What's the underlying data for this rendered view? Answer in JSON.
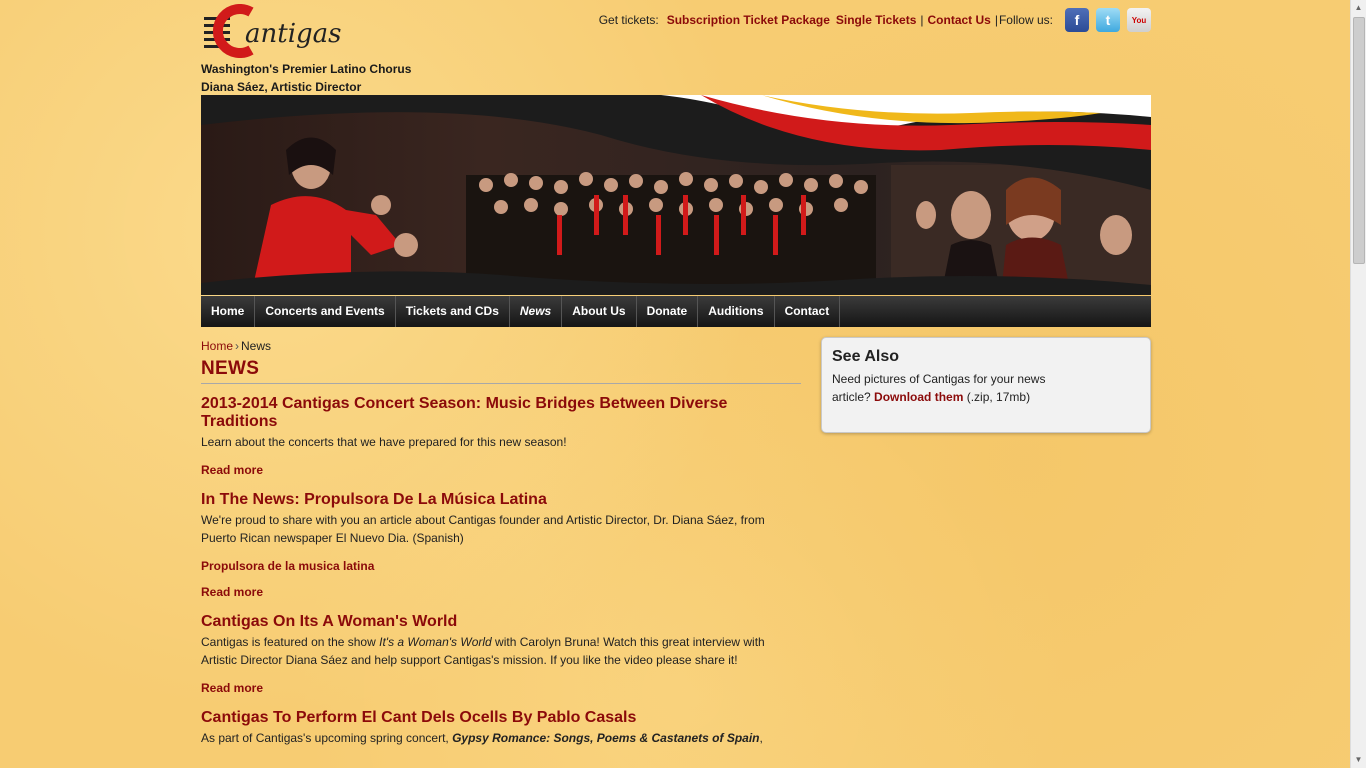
{
  "site": {
    "logo_text": "Cantigas",
    "tagline_1": "Washington's Premier Latino Chorus",
    "tagline_2": "Diana Sáez, Artistic Director"
  },
  "topbar": {
    "get_tickets_label": "Get tickets:",
    "subscription": "Subscription Ticket Package",
    "single": "Single Tickets",
    "contact": "Contact Us",
    "follow_label": "Follow us:",
    "social_icons": [
      "facebook-icon",
      "twitter-icon",
      "youtube-icon"
    ]
  },
  "nav": {
    "items": [
      "Home",
      "Concerts and Events",
      "Tickets and CDs",
      "News",
      "About Us",
      "Donate",
      "Auditions",
      "Contact"
    ],
    "active": "News"
  },
  "breadcrumb": {
    "home": "Home",
    "current": "News"
  },
  "page_title": "NEWS",
  "posts": [
    {
      "title": "2013-2014 Cantigas Concert Season: Music Bridges Between Diverse Traditions",
      "body": "Learn about the concerts that we have prepared for this new season!",
      "read_more": "Read more"
    },
    {
      "title": "In The News: Propulsora De La Música Latina",
      "body": "We're proud to share with you an article about Cantigas founder and Artistic Director, Dr. Diana Sáez, from Puerto Rican newspaper El Nuevo Dia. (Spanish)",
      "link": "Propulsora de la musica latina",
      "read_more": "Read more"
    },
    {
      "title": "Cantigas On Its A Woman's World",
      "body_pre": "Cantigas is featured on the show ",
      "body_em": "It's a Woman's World",
      "body_post": " with Carolyn Bruna! Watch this great interview with Artistic Director Diana Sáez and help support Cantigas's mission. If you like the video please share it!",
      "read_more": "Read more"
    },
    {
      "title": "Cantigas To Perform El Cant Dels Ocells By Pablo Casals",
      "body_pre": "As part of Cantigas's upcoming spring concert, ",
      "body_em": "Gypsy Romance: Songs, Poems & Castanets of Spain",
      "body_post": ","
    }
  ],
  "sidebar": {
    "title": "See Also",
    "text_pre": "Need pictures of Cantigas for your news article? ",
    "link": "Download them",
    "text_post": " (.zip, 17mb)"
  },
  "colors": {
    "accent": "#8b0a0a",
    "background": "#f7cc72",
    "nav": "#1f1f1f",
    "brand_red": "#d11a1a",
    "brand_yellow": "#f0b81a"
  }
}
